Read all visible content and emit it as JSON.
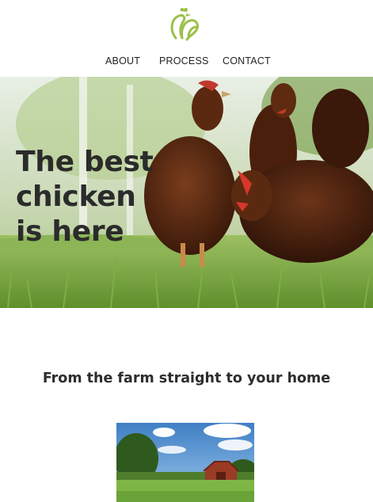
{
  "nav": {
    "items": [
      {
        "label": "ABOUT"
      },
      {
        "label": "PROCESS"
      },
      {
        "label": "CONTACT"
      }
    ]
  },
  "logo": {
    "icon": "rooster-logo-icon",
    "color": "#9cc04a"
  },
  "hero": {
    "title_lines": [
      "The best",
      "chicken",
      "is here"
    ],
    "image": "hens-on-grass-photo"
  },
  "section": {
    "heading": "From the farm straight to your home",
    "image": "red-barn-field-photo"
  },
  "colors": {
    "accent": "#9cc04a",
    "text": "#2b2b2b",
    "background": "#ffffff"
  }
}
